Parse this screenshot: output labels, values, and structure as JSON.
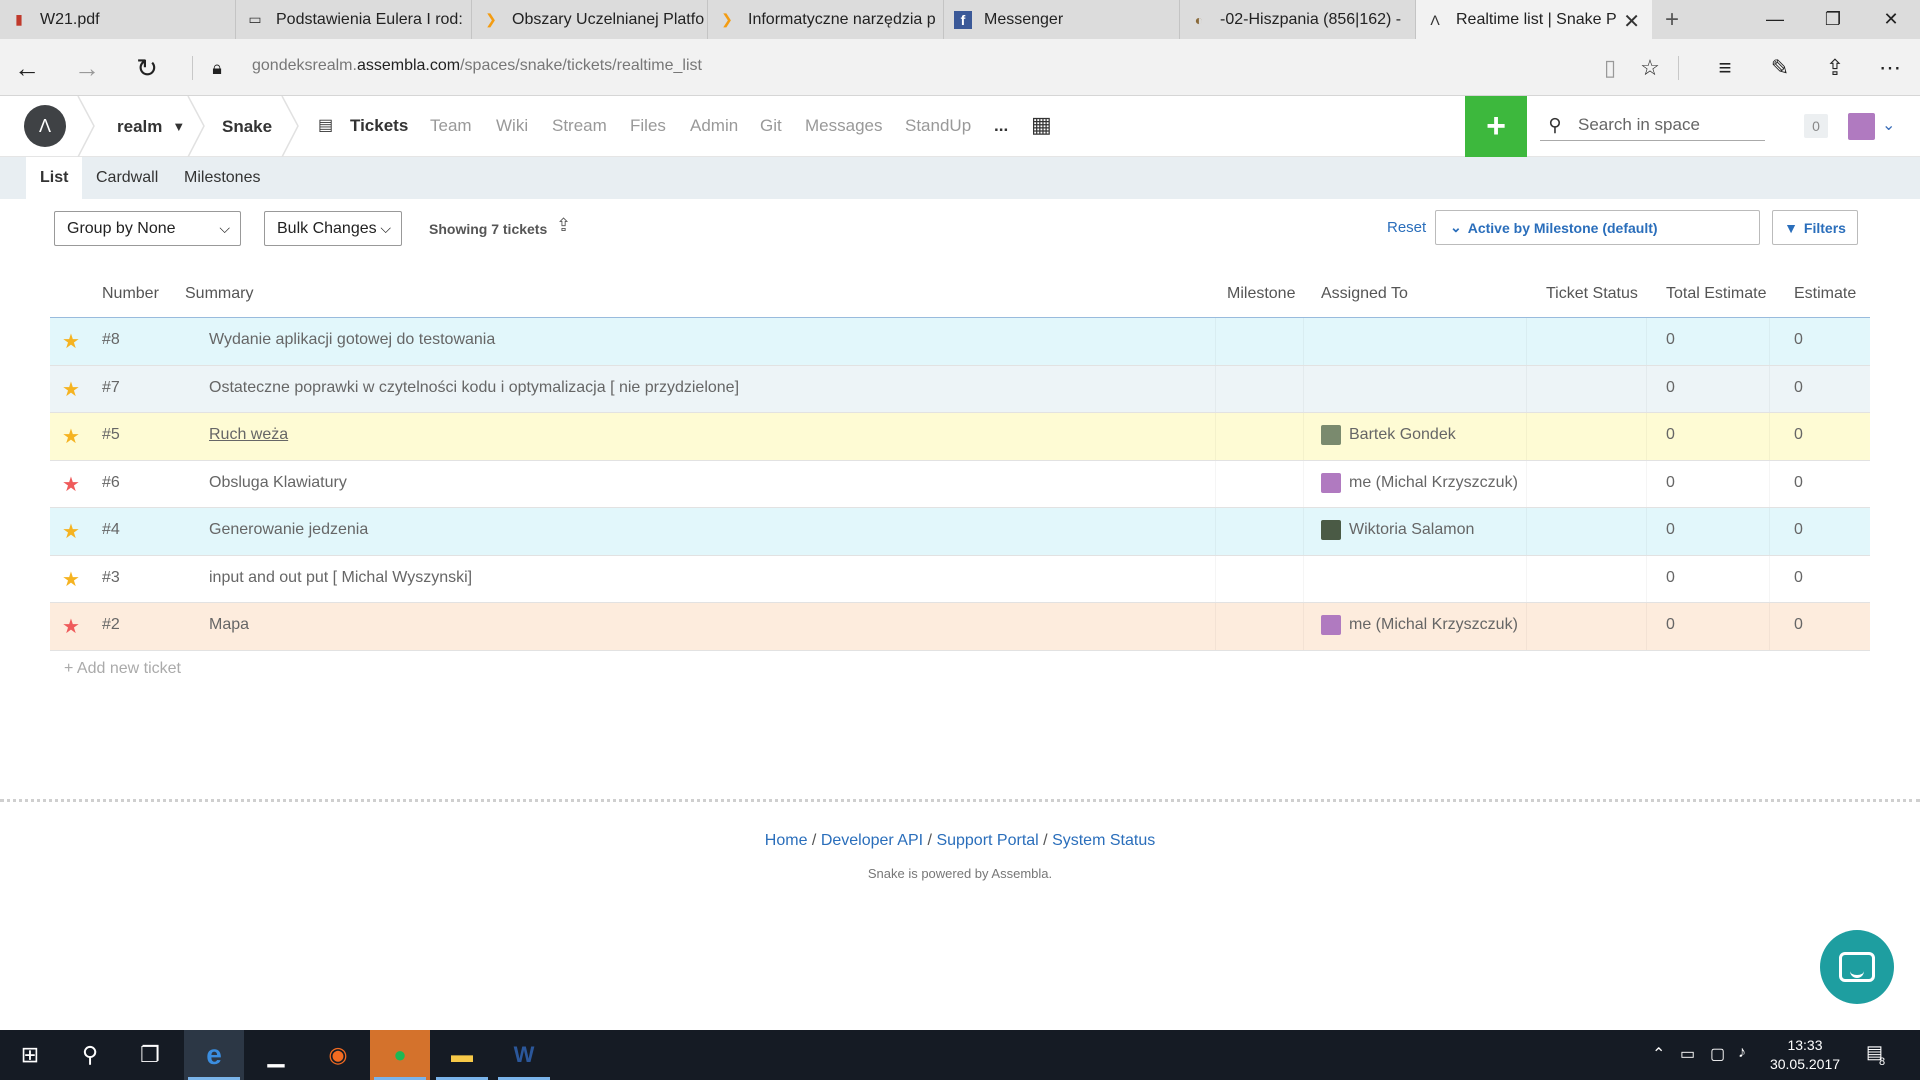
{
  "browser": {
    "tabs": [
      {
        "title": "W21.pdf",
        "icon": "pdf-icon"
      },
      {
        "title": "Podstawienia Eulera I rod:",
        "icon": "page-icon"
      },
      {
        "title": "Obszary Uczelnianej Platfo",
        "icon": "moodle-icon"
      },
      {
        "title": "Informatyczne narzędzia p",
        "icon": "moodle-icon"
      },
      {
        "title": "Messenger",
        "icon": "facebook-icon"
      },
      {
        "title": "-02-Hiszpania (856|162) -",
        "icon": "site-icon"
      },
      {
        "title": "Realtime list | Snake P",
        "icon": "assembla-icon",
        "active": true
      }
    ],
    "url": {
      "prefix": "gondeksrealm.",
      "domain": "assembla.com",
      "path": "/spaces/snake/tickets/realtime_list"
    }
  },
  "header": {
    "org": "realm",
    "space": "Snake",
    "nav": [
      "Tickets",
      "Team",
      "Wiki",
      "Stream",
      "Files",
      "Admin",
      "Git",
      "Messages",
      "StandUp",
      "..."
    ],
    "active_nav": "Tickets",
    "search_placeholder": "Search in space",
    "notif_count": "0",
    "plus_label": "+"
  },
  "subtabs": [
    "List",
    "Cardwall",
    "Milestones"
  ],
  "toolbar": {
    "group_by": "Group by None",
    "bulk": "Bulk Changes",
    "showing": "Showing 7 tickets",
    "reset": "Reset",
    "milestone_filter": "Active by Milestone (default)",
    "filters": "Filters"
  },
  "table": {
    "columns": [
      "Number",
      "Summary",
      "Milestone",
      "Assigned To",
      "Ticket Status",
      "Total Estimate",
      "Estimate"
    ],
    "rows": [
      {
        "number": "#8",
        "summary": "Wydanie aplikacji gotowej do testowania",
        "milestone": "",
        "assigned": "",
        "status": "",
        "total": "0",
        "estimate": "0",
        "bg": "#e2f7fb",
        "star": "#f5b321"
      },
      {
        "number": "#7",
        "summary": "Ostateczne poprawki w czytelności kodu i optymalizacja [ nie przydzielone]",
        "milestone": "",
        "assigned": "",
        "status": "",
        "total": "0",
        "estimate": "0",
        "bg": "#edf4f7",
        "star": "#f5b321"
      },
      {
        "number": "#5",
        "summary": "Ruch weża",
        "milestone": "",
        "assigned": "Bartek Gondek",
        "status": "",
        "total": "0",
        "estimate": "0",
        "bg": "#fefbd4",
        "star": "#f5b321",
        "link": true,
        "avatar": "#7a8a6e"
      },
      {
        "number": "#6",
        "summary": "Obsluga Klawiatury",
        "milestone": "",
        "assigned": "me (Michal Krzyszczuk)",
        "status": "",
        "total": "0",
        "estimate": "0",
        "bg": "#ffffff",
        "star": "#ef5b5b",
        "avatar": "#b07ac0"
      },
      {
        "number": "#4",
        "summary": "Generowanie jedzenia",
        "milestone": "",
        "assigned": "Wiktoria Salamon",
        "status": "",
        "total": "0",
        "estimate": "0",
        "bg": "#e2f7fb",
        "star": "#f5b321",
        "avatar": "#4a5a45"
      },
      {
        "number": "#3",
        "summary": "input and out put [ Michal Wyszynski]",
        "milestone": "",
        "assigned": "",
        "status": "",
        "total": "0",
        "estimate": "0",
        "bg": "#ffffff",
        "star": "#f5b321"
      },
      {
        "number": "#2",
        "summary": "Mapa",
        "milestone": "",
        "assigned": "me (Michal Krzyszczuk)",
        "status": "",
        "total": "0",
        "estimate": "0",
        "bg": "#fdecdd",
        "star": "#ef5b5b",
        "avatar": "#b07ac0"
      }
    ],
    "add_new": "+ Add new ticket"
  },
  "footer": {
    "links": [
      "Home",
      "Developer API",
      "Support Portal",
      "System Status"
    ],
    "powered": "Snake is powered by Assembla."
  },
  "taskbar": {
    "time": "13:33",
    "date": "30.05.2017",
    "notif": "8"
  }
}
